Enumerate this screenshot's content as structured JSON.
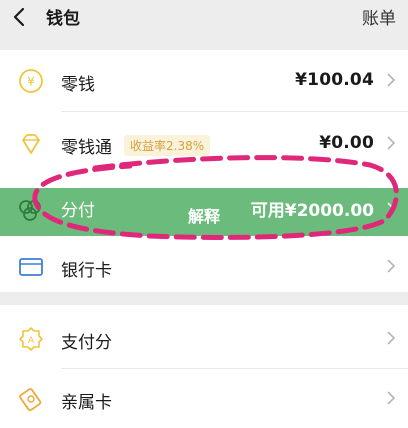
{
  "header": {
    "title": "钱包",
    "right_label": "账单"
  },
  "items": [
    {
      "label": "零钱",
      "value": "¥100.04",
      "icon": "coin-icon"
    },
    {
      "label": "零钱通",
      "badge": "收益率2.38%",
      "value": "¥0.00",
      "icon": "diamond-icon"
    },
    {
      "label": "分付",
      "value": "可用¥2000.00",
      "icon": "clover-icon"
    },
    {
      "label": "银行卡",
      "icon": "card-icon"
    }
  ],
  "section2": [
    {
      "label": "支付分",
      "icon": "badge-icon"
    },
    {
      "label": "亲属卡",
      "icon": "family-card-icon"
    }
  ],
  "overlay": {
    "text": "解释"
  },
  "colors": {
    "accent_green": "#56b36a",
    "highlight": "#e0287a",
    "icon_yellow": "#f0c43c"
  }
}
